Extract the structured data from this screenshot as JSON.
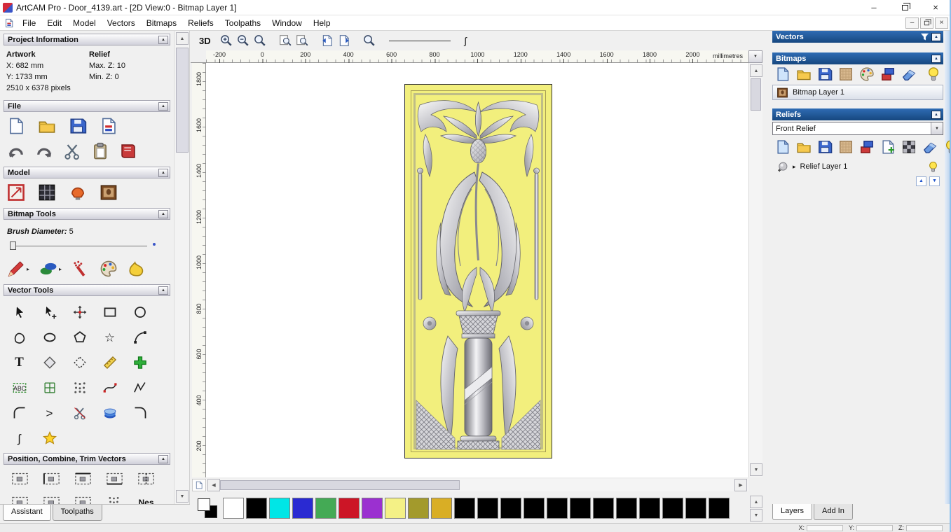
{
  "window": {
    "title": "ArtCAM Pro - Door_4139.art - [2D View:0 - Bitmap Layer 1]"
  },
  "glyphs": {
    "up": "▲",
    "down": "▼",
    "left": "◀",
    "right": "▶",
    "flyout": "▸",
    "star": "☆",
    "text_tool": "T",
    "curve": "ʃ",
    "gt": ">",
    "minimize": "–",
    "close": "×"
  },
  "menubar": {
    "items": [
      "File",
      "Edit",
      "Model",
      "Vectors",
      "Bitmaps",
      "Reliefs",
      "Toolpaths",
      "Window",
      "Help"
    ]
  },
  "assistant": {
    "project_information": {
      "title": "Project Information",
      "artwork_label": "Artwork",
      "relief_label": "Relief",
      "x": "X: 682 mm",
      "y": "Y: 1733 mm",
      "max_z": "Max. Z: 10",
      "min_z": "Min. Z: 0",
      "pixels": "2510 x 6378 pixels"
    },
    "file": {
      "title": "File",
      "icon_names": [
        "new-model",
        "open-model",
        "save-model",
        "import-model",
        "undo",
        "redo",
        "cut",
        "paste",
        "reduce-colours"
      ]
    },
    "model": {
      "title": "Model",
      "icon_names": [
        "set-model-size",
        "set-model-position",
        "adjust-lighting",
        "load-picture"
      ]
    },
    "bitmap_tools": {
      "title": "Bitmap Tools",
      "brush_label": "Brush Diameter:",
      "brush_value": "5",
      "icon_names": [
        "paint-pencil",
        "paint-selected-colour",
        "airbrush",
        "colour-palette",
        "flood-fill"
      ]
    },
    "vector_tools": {
      "title": "Vector Tools",
      "icon_names": [
        "select-vectors",
        "node-editing",
        "transform-vectors",
        "create-rectangle",
        "create-circle",
        "create-polyline",
        "create-ellipse",
        "create-polygon",
        "create-star",
        "create-arc",
        "create-text",
        "offset-vector",
        "trim-to-vector",
        "measure",
        "block-copy-rotate",
        "text-on-curve",
        "envelope-distort",
        "paste-along-curve",
        "fit-arcs",
        "fit-polyline",
        "join-vectors",
        "close-vector",
        "cut-vector",
        "interactive-distortion",
        "fillet-corner",
        "section-profile",
        "wrap-vectors"
      ]
    },
    "position": {
      "title": "Position, Combine, Trim Vectors",
      "nest_label": "Nes",
      "icon_names": [
        "center-in-page",
        "align-left",
        "align-top",
        "align-bottom",
        "align-center",
        "mirror-vectors",
        "block-replicate",
        "group-vectors",
        "measure-distance",
        "nest"
      ]
    },
    "tabs": [
      {
        "label": "Assistant",
        "active": true
      },
      {
        "label": "Toolpaths",
        "active": false
      }
    ]
  },
  "view_toolbar": {
    "view_3d": "3D",
    "icon_names": [
      "zoom-in",
      "zoom-out",
      "zoom-previous",
      "zoom-window",
      "zoom-objects",
      "zoom-fit",
      "snap-page-left",
      "snap-page-right",
      "zoom-scale",
      "line-width-preview",
      "curve-preview"
    ]
  },
  "ruler": {
    "units": "millimetres",
    "h_ticks": [
      "-200",
      "0",
      "200",
      "400",
      "600",
      "800",
      "1000",
      "1200",
      "1400",
      "1600",
      "1800",
      "2000"
    ],
    "v_ticks": [
      "1800",
      "1600",
      "1400",
      "1200",
      "1000",
      "800",
      "600",
      "400",
      "200"
    ]
  },
  "door_artwork": {
    "background": "#f2ef7d",
    "content": "Ornate baroque door relief preview: symmetric acanthus scrolls, central palmette and pinecone, fluted column with diagonal drape on lattice ground"
  },
  "layers_panel": {
    "vectors_title": "Vectors",
    "bitmaps_title": "Bitmaps",
    "bitmap_layer_label": "Bitmap Layer 1",
    "bitmaps_icon_names": [
      "new-bitmap",
      "open-bitmap",
      "save-bitmap",
      "texture-bitmap",
      "colour-reduce",
      "merge-bitmaps",
      "delete-bitmap",
      "toggle-visibility"
    ],
    "reliefs_title": "Reliefs",
    "relief_selector": "Front Relief",
    "relief_layer_label": "Relief Layer 1",
    "reliefs_icon_names": [
      "new-relief",
      "open-relief",
      "save-relief",
      "texture-relief",
      "combine-relief",
      "add-relief-layer",
      "pattern-relief",
      "delete-relief",
      "toggle-visibility"
    ],
    "tabs": [
      {
        "label": "Layers",
        "active": true
      },
      {
        "label": "Add In",
        "active": false
      }
    ]
  },
  "palette": {
    "colors": [
      "#ffffff",
      "#000000",
      "#00e6e6",
      "#2a2ad2",
      "#44aa55",
      "#cc1526",
      "#9b30d0",
      "#f4f186",
      "#a39a2c",
      "#d9ae25",
      "#000000",
      "#000000",
      "#000000",
      "#000000",
      "#000000",
      "#000000",
      "#000000",
      "#000000",
      "#000000",
      "#000000",
      "#000000",
      "#000000"
    ]
  },
  "status_bar": {
    "x_label": "X:",
    "y_label": "Y:",
    "z_label": "Z:"
  }
}
